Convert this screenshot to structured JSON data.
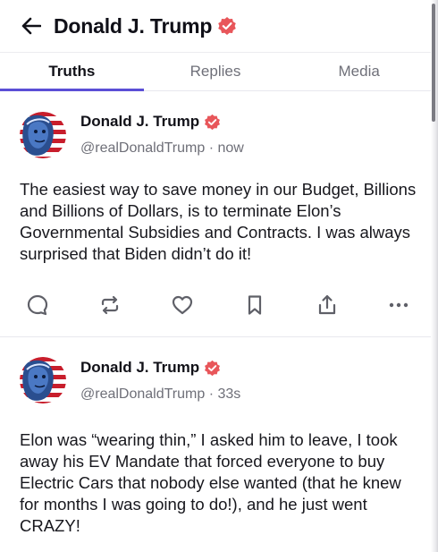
{
  "header": {
    "title": "Donald J. Trump"
  },
  "tabs": [
    {
      "label": "Truths",
      "active": true
    },
    {
      "label": "Replies",
      "active": false
    },
    {
      "label": "Media",
      "active": false
    }
  ],
  "posts": [
    {
      "author": "Donald J. Trump",
      "handle": "@realDonaldTrump",
      "separator": "·",
      "time": "now",
      "text": "The easiest way to save money in our Budget, Billions and Billions of Dollars, is to terminate Elon’s Governmental Subsidies and Contracts. I was always surprised that Biden didn’t do it!"
    },
    {
      "author": "Donald J. Trump",
      "handle": "@realDonaldTrump",
      "separator": "·",
      "time": "33s",
      "text": "Elon was “wearing thin,” I asked him to leave, I took away his EV Mandate that forced everyone to buy Electric Cars that nobody else wanted (that he knew for months I was going to do!), and he just went CRAZY!"
    }
  ],
  "icons": {
    "back": "arrow-left-icon",
    "verified": "verified-badge-icon",
    "reply": "speech-bubble-icon",
    "retruth": "repost-arrows-icon",
    "like": "heart-icon",
    "save": "bookmark-icon",
    "share": "share-upload-icon",
    "more": "ellipsis-icon"
  },
  "colors": {
    "accent": "#5b4fd6",
    "verified": "#e8565a",
    "muted_text": "#6e6f78",
    "icon_gray": "#5f6068"
  }
}
